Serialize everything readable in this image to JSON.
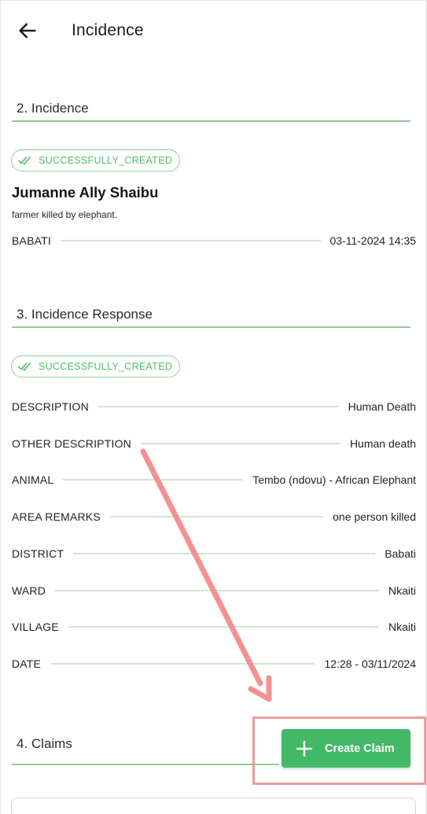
{
  "header": {
    "title": "Incidence"
  },
  "incidence": {
    "section_title": "2. Incidence",
    "status": "SUCCESSFULLY_CREATED",
    "name": "Jumanne Ally Shaibu",
    "description": "farmer  killed by elephant.",
    "location": "BABATI",
    "datetime": "03-11-2024  14:35"
  },
  "response": {
    "section_title": "3. Incidence Response",
    "status": "SUCCESSFULLY_CREATED",
    "rows": [
      {
        "label": "DESCRIPTION",
        "value": "Human Death"
      },
      {
        "label": "OTHER DESCRIPTION",
        "value": "Human death"
      },
      {
        "label": "ANIMAL",
        "value": "Tembo (ndovu) - African Elephant"
      },
      {
        "label": "AREA REMARKS",
        "value": "one person killed"
      },
      {
        "label": "DISTRICT",
        "value": "Babati"
      },
      {
        "label": "WARD",
        "value": "Nkaiti"
      },
      {
        "label": "VILLAGE",
        "value": "Nkaiti"
      },
      {
        "label": "DATE",
        "value": "12:28 - 03/11/2024"
      }
    ]
  },
  "claims": {
    "section_title": "4. Claims",
    "create_button_label": "Create Claim"
  },
  "icons": {
    "back": "arrow-left-icon",
    "status": "double-check-icon",
    "add": "plus-icon"
  },
  "colors": {
    "accent_green": "#43b867",
    "badge_green": "#4cbf62",
    "annotation_red": "#f19a9a"
  }
}
